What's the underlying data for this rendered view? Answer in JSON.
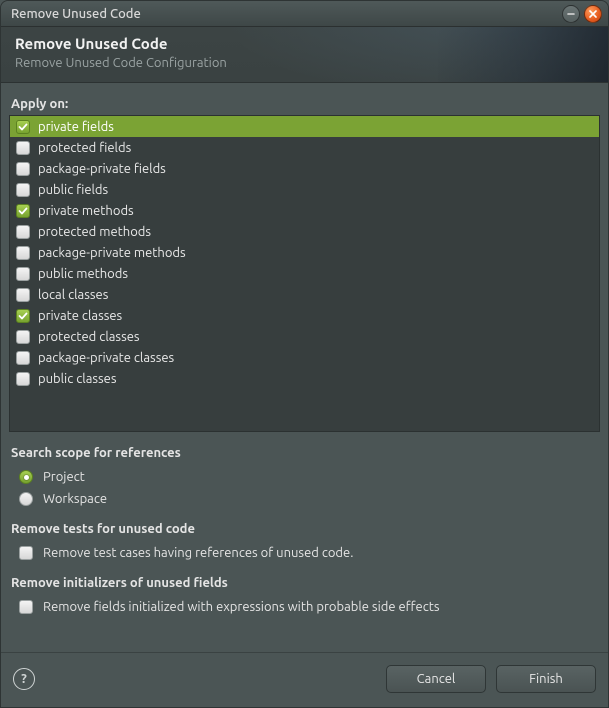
{
  "window": {
    "title": "Remove Unused Code"
  },
  "banner": {
    "title": "Remove Unused Code",
    "subtitle": "Remove Unused Code Configuration"
  },
  "applyOn": {
    "label": "Apply on:",
    "items": [
      {
        "label": "private fields",
        "checked": true,
        "selected": true
      },
      {
        "label": "protected fields",
        "checked": false,
        "selected": false
      },
      {
        "label": "package-private fields",
        "checked": false,
        "selected": false
      },
      {
        "label": "public fields",
        "checked": false,
        "selected": false
      },
      {
        "label": "private methods",
        "checked": true,
        "selected": false
      },
      {
        "label": "protected methods",
        "checked": false,
        "selected": false
      },
      {
        "label": "package-private methods",
        "checked": false,
        "selected": false
      },
      {
        "label": "public methods",
        "checked": false,
        "selected": false
      },
      {
        "label": "local classes",
        "checked": false,
        "selected": false
      },
      {
        "label": "private classes",
        "checked": true,
        "selected": false
      },
      {
        "label": "protected classes",
        "checked": false,
        "selected": false
      },
      {
        "label": "package-private classes",
        "checked": false,
        "selected": false
      },
      {
        "label": "public classes",
        "checked": false,
        "selected": false
      }
    ]
  },
  "scope": {
    "label": "Search scope for references",
    "options": [
      {
        "label": "Project",
        "checked": true
      },
      {
        "label": "Workspace",
        "checked": false
      }
    ]
  },
  "removeTests": {
    "label": "Remove tests for unused code",
    "option": {
      "label": "Remove test cases having references of unused code.",
      "checked": false
    }
  },
  "removeInit": {
    "label": "Remove initializers of unused fields",
    "option": {
      "label": "Remove fields initialized with expressions with probable side effects",
      "checked": false
    }
  },
  "footer": {
    "help": "?",
    "cancel": "Cancel",
    "finish": "Finish"
  },
  "icons": {
    "minimize": "minimize-icon",
    "close": "close-icon",
    "check": "check-icon"
  }
}
